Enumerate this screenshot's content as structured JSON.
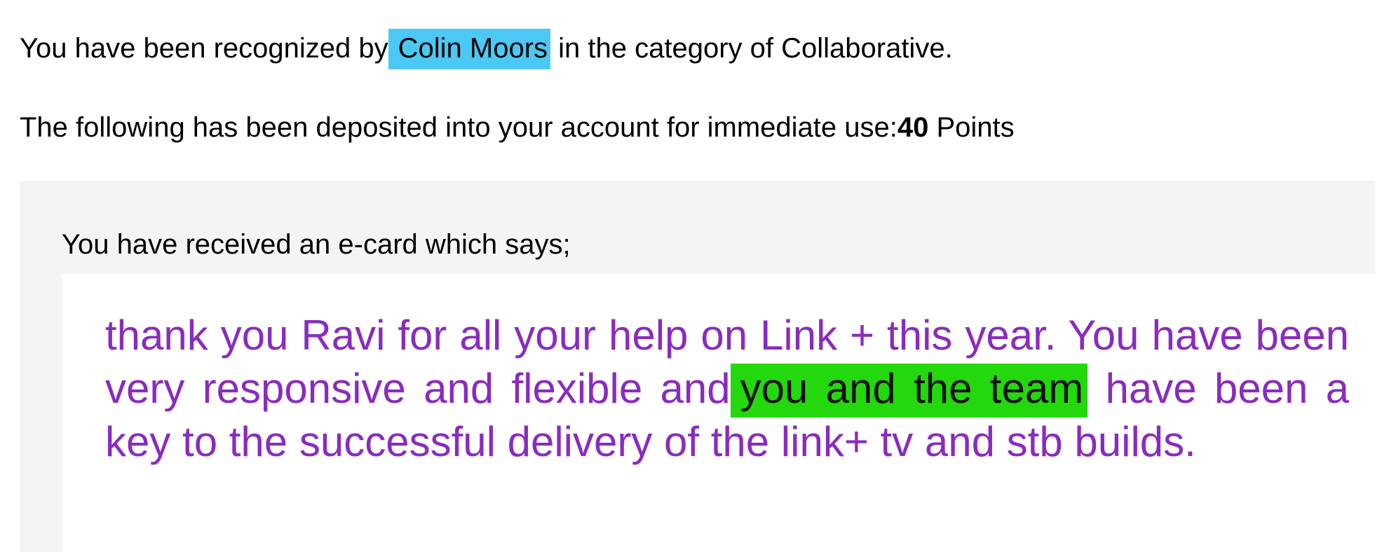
{
  "recognition": {
    "prefix": "You have been recognized by",
    "sender_name": "Colin Moors",
    "suffix": "in the category of Collaborative."
  },
  "deposit": {
    "prefix": "The following has been deposited into your account for immediate use:",
    "points_value": "40",
    "points_unit": "Points"
  },
  "ecard": {
    "intro": "You have received an e-card which says;",
    "message_before": "thank you Ravi for all your help on Link + this year. You have been very responsive and flexible and",
    "message_highlight": "you and the team",
    "message_after": "have been a key to the successful delivery of the link+ tv and stb builds."
  },
  "colors": {
    "name_highlight": "#4cc8f4",
    "message_text": "#8a2bbf",
    "message_highlight": "#23d80c",
    "panel_background": "#f4f4f4"
  }
}
